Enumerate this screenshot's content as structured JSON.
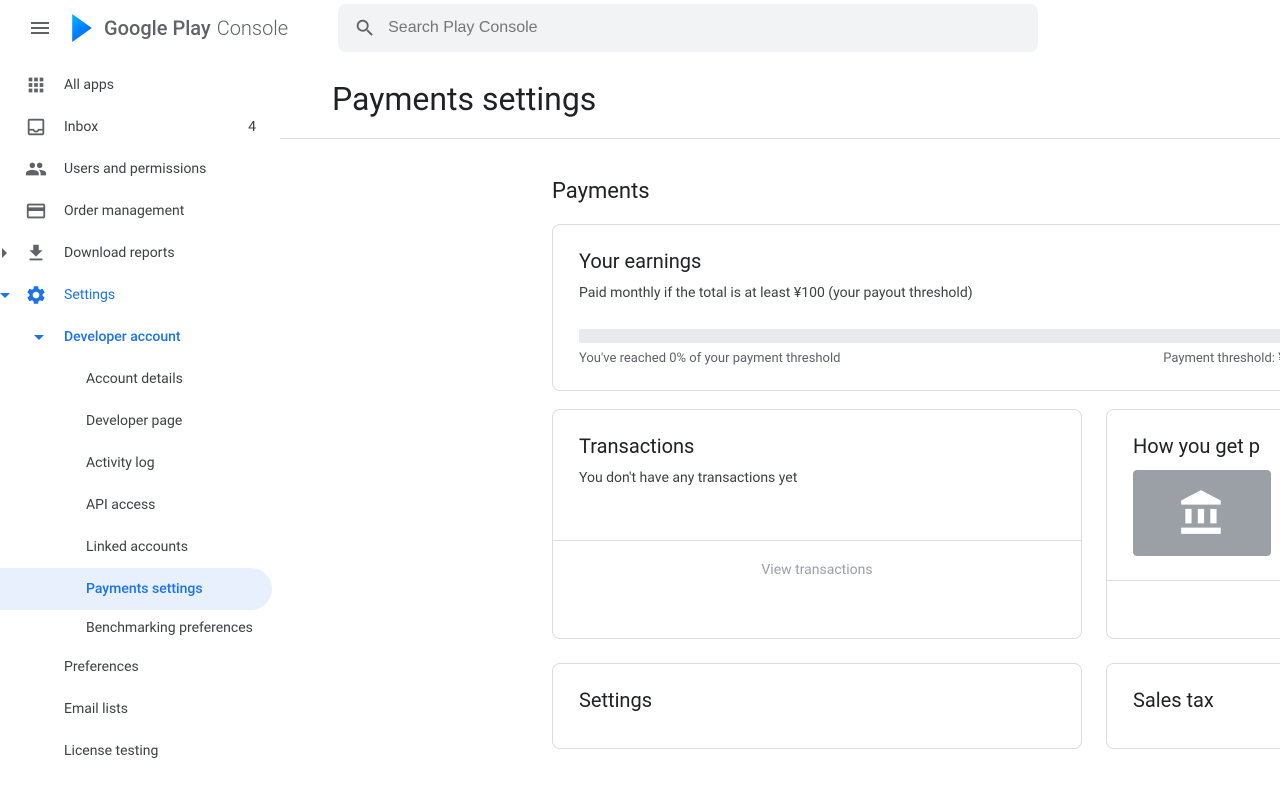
{
  "header": {
    "logo_main": "Google Play",
    "logo_sub": "Console",
    "search_placeholder": "Search Play Console"
  },
  "sidebar": {
    "all_apps": "All apps",
    "inbox": "Inbox",
    "inbox_count": "4",
    "users": "Users and permissions",
    "orders": "Order management",
    "downloads": "Download reports",
    "settings": "Settings",
    "dev_account": "Developer account",
    "account_details": "Account details",
    "dev_page": "Developer page",
    "activity_log": "Activity log",
    "api_access": "API access",
    "linked_accounts": "Linked accounts",
    "payments_settings": "Payments settings",
    "benchmarking": "Benchmarking preferences",
    "preferences": "Preferences",
    "email_lists": "Email lists",
    "license_testing": "License testing"
  },
  "page": {
    "title": "Payments settings",
    "section_payments": "Payments",
    "earnings": {
      "title": "Your earnings",
      "subtitle": "Paid monthly if the total is at least ¥100 (your payout threshold)",
      "progress_left": "You've reached 0% of your payment threshold",
      "progress_right": "Payment threshold: ¥"
    },
    "transactions": {
      "title": "Transactions",
      "empty": "You don't have any transactions yet",
      "view_btn": "View transactions"
    },
    "how_paid": {
      "title": "How you get p"
    },
    "settings_card": {
      "title": "Settings"
    },
    "sales_tax": {
      "title": "Sales tax"
    }
  }
}
